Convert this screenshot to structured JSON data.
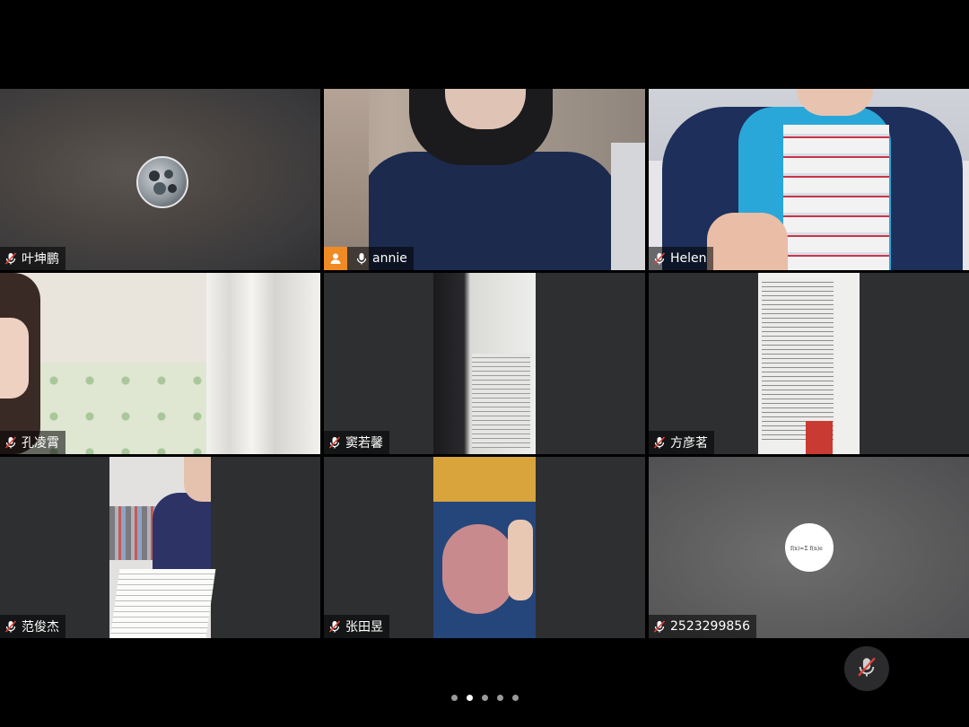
{
  "participants": [
    {
      "name": "叶坤鹏",
      "mic": "muted"
    },
    {
      "name": "annie",
      "mic": "on",
      "active_speaker": true
    },
    {
      "name": "Helen",
      "mic": "muted"
    },
    {
      "name": "孔凌霄",
      "mic": "muted"
    },
    {
      "name": "窦若馨",
      "mic": "muted"
    },
    {
      "name": "方彦茗",
      "mic": "muted"
    },
    {
      "name": "范俊杰",
      "mic": "muted"
    },
    {
      "name": "张田昱",
      "mic": "muted"
    },
    {
      "name": "2523299856",
      "mic": "muted"
    }
  ],
  "controls": {
    "mic_state": "muted",
    "mic_icon": "mic-muted-icon"
  },
  "pagination": {
    "pages": 5,
    "current": 2
  },
  "colors": {
    "active_border": "#2bbf52",
    "host_badge": "#f08a24",
    "muted_red": "#e0413a"
  }
}
